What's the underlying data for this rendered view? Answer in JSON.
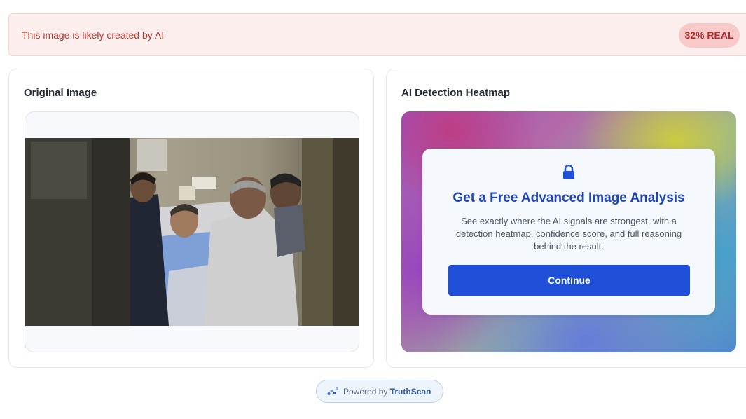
{
  "banner": {
    "message": "This image is likely created by AI",
    "badge": "32% REAL",
    "colors": {
      "background": "#fdeeee",
      "text": "#c0392b",
      "badge_bg": "#f8c9c9"
    }
  },
  "original_panel": {
    "title": "Original Image",
    "image_alt": "hospital-room-photo"
  },
  "heatmap_panel": {
    "title": "AI Detection Heatmap",
    "modal": {
      "icon": "lock-icon",
      "title": "Get a Free Advanced Image Analysis",
      "description": "See exactly where the AI signals are strongest, with a detection heatmap, confidence score, and full reasoning behind the result.",
      "button_label": "Continue"
    },
    "colors": {
      "title": "#1e44b8",
      "button": "#1e4fd6"
    }
  },
  "footer": {
    "prefix": "Powered by",
    "brand": "TruthScan",
    "icon": "truthscan-logo-icon"
  }
}
